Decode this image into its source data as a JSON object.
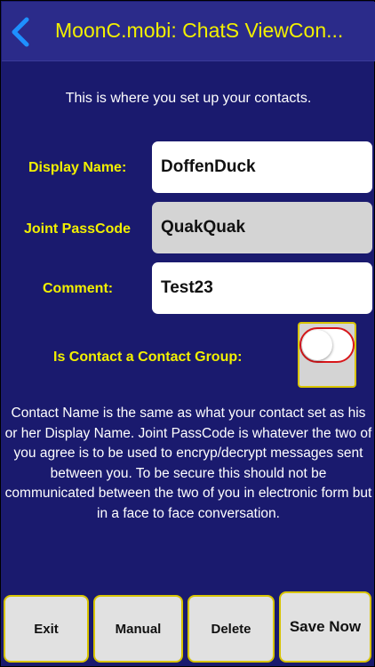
{
  "nav": {
    "title": "MoonC.mobi: ChatS ViewCon...",
    "back_icon": "chevron-left-icon"
  },
  "intro": "This is where you set up your contacts.",
  "form": {
    "display_name_label": "Display Name:",
    "display_name_value": "DoffenDuck",
    "passcode_label": "Joint PassCode",
    "passcode_value": "QuakQuak",
    "comment_label": "Comment:",
    "comment_value": "Test23",
    "group_label": "Is Contact a Contact Group:",
    "group_toggle_on": false
  },
  "help_text": "Contact Name is the same as what your contact set as his or her Display Name. Joint PassCode is whatever the two of you agree is to be used to encryp/decrypt messages sent between you. To be secure this should not be communicated between the two of you in electronic form but in a face to face conversation.",
  "buttons": {
    "exit": "Exit",
    "manual": "Manual",
    "delete": "Delete",
    "save": "Save Now"
  },
  "colors": {
    "background": "#1a1a6e",
    "accent_yellow": "#f2f000",
    "back_blue": "#1e90ff",
    "toggle_red": "#d8161a"
  }
}
